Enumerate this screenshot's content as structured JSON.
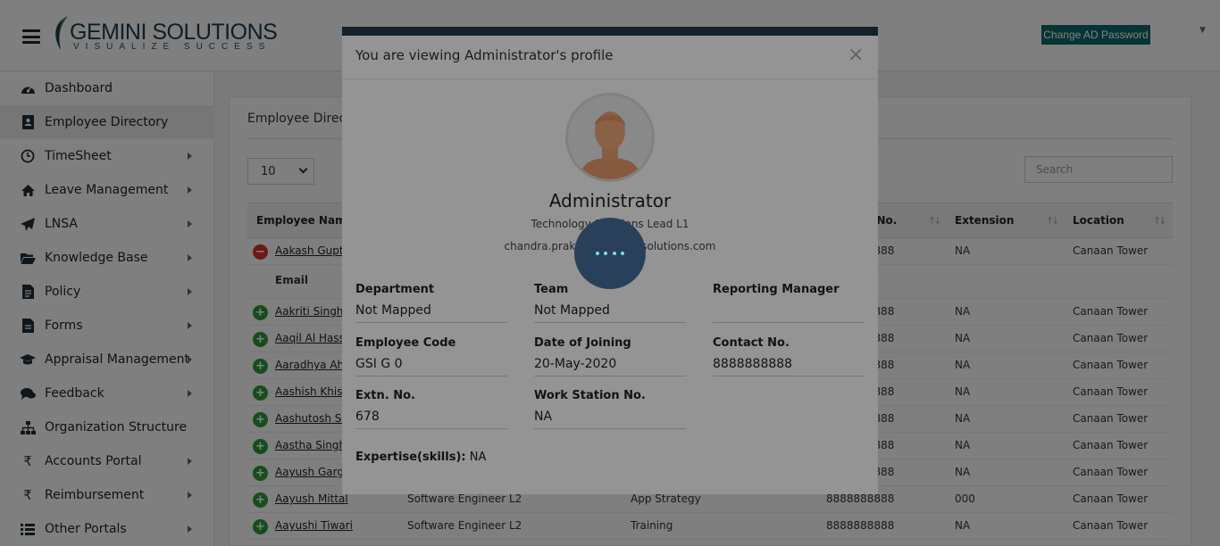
{
  "header": {
    "logo_title": "GEMINI SOLUTIONS",
    "logo_tagline": "VISUALIZE SUCCESS",
    "change_password_label": "Change AD Password",
    "brand_color": "#0f6b6b"
  },
  "sidebar": {
    "items": [
      {
        "label": "Dashboard",
        "icon": "dashboard-icon",
        "has_submenu": false
      },
      {
        "label": "Employee Directory",
        "icon": "address-book-icon",
        "has_submenu": false,
        "active": true
      },
      {
        "label": "TimeSheet",
        "icon": "clock-icon",
        "has_submenu": true
      },
      {
        "label": "Leave Management",
        "icon": "home-icon",
        "has_submenu": true
      },
      {
        "label": "LNSA",
        "icon": "paper-plane-icon",
        "has_submenu": true
      },
      {
        "label": "Knowledge Base",
        "icon": "folder-open-icon",
        "has_submenu": true
      },
      {
        "label": "Policy",
        "icon": "document-icon",
        "has_submenu": true
      },
      {
        "label": "Forms",
        "icon": "form-icon",
        "has_submenu": true
      },
      {
        "label": "Appraisal Management",
        "icon": "graduation-cap-icon",
        "has_submenu": true
      },
      {
        "label": "Feedback",
        "icon": "comments-icon",
        "has_submenu": true
      },
      {
        "label": "Organization Structure",
        "icon": "sitemap-icon",
        "has_submenu": false
      },
      {
        "label": "Accounts Portal",
        "icon": "rupee-icon",
        "has_submenu": true
      },
      {
        "label": "Reimbursement",
        "icon": "rupee-icon",
        "has_submenu": true
      },
      {
        "label": "Other Portals",
        "icon": "list-icon",
        "has_submenu": true
      }
    ]
  },
  "directory": {
    "title": "Employee Directory",
    "page_size": "10",
    "search_placeholder": "Search",
    "columns": {
      "name": "Employee Name",
      "contact": "Contact No.",
      "extension": "Extension",
      "location": "Location"
    },
    "detail_label": "Email",
    "rows": [
      {
        "name": "Aakash Gupta",
        "designation": "",
        "team": "",
        "contact": "8888888888",
        "extension": "NA",
        "location": "Canaan Tower",
        "expanded": true
      },
      {
        "name": "Aakriti Singhal",
        "designation": "",
        "team": "",
        "contact": "8888888888",
        "extension": "NA",
        "location": "Canaan Tower"
      },
      {
        "name": "Aaqil Al Hassan",
        "designation": "",
        "team": "",
        "contact": "8888888888",
        "extension": "NA",
        "location": "Canaan Tower"
      },
      {
        "name": "Aaradhya Ahuja",
        "designation": "",
        "team": "",
        "contact": "8888888888",
        "extension": "NA",
        "location": "Canaan Tower"
      },
      {
        "name": "Aashish Khistri",
        "designation": "",
        "team": "",
        "contact": "8888888888",
        "extension": "NA",
        "location": "Canaan Tower"
      },
      {
        "name": "Aashutosh Sharma",
        "designation": "",
        "team": "",
        "contact": "8888888888",
        "extension": "NA",
        "location": "Canaan Tower"
      },
      {
        "name": "Aastha Singh",
        "designation": "",
        "team": "",
        "contact": "8888888888",
        "extension": "NA",
        "location": "Canaan Tower"
      },
      {
        "name": "Aayush Garg",
        "designation": "",
        "team": "",
        "contact": "8888888888",
        "extension": "NA",
        "location": "Canaan Tower"
      },
      {
        "name": "Aayush Mittal",
        "designation": "Software Engineer L2",
        "team": "App Strategy",
        "contact": "8888888888",
        "extension": "000",
        "location": "Canaan Tower"
      },
      {
        "name": "Aayushi Tiwari",
        "designation": "Software Engineer L2",
        "team": "Training",
        "contact": "8888888888",
        "extension": "NA",
        "location": "Canaan Tower"
      }
    ]
  },
  "modal": {
    "title": "You are viewing Administrator's profile",
    "close_symbol": "×",
    "name": "Administrator",
    "role": "Technology Solutions Lead L1",
    "email": "chandra.prakash@geminisolutions.com",
    "fields": {
      "department": {
        "label": "Department",
        "value": "Not Mapped"
      },
      "team": {
        "label": "Team",
        "value": "Not Mapped"
      },
      "reporting_manager": {
        "label": "Reporting Manager",
        "value": ""
      },
      "employee_code": {
        "label": "Employee Code",
        "value": "GSI G 0"
      },
      "date_of_joining": {
        "label": "Date of Joining",
        "value": "20-May-2020"
      },
      "contact_no": {
        "label": "Contact No.",
        "value": "8888888888"
      },
      "extn_no": {
        "label": "Extn. No.",
        "value": "678"
      },
      "work_station_no": {
        "label": "Work Station No.",
        "value": "NA"
      }
    },
    "skills_label": "Expertise(skills):",
    "skills_value": "NA"
  }
}
